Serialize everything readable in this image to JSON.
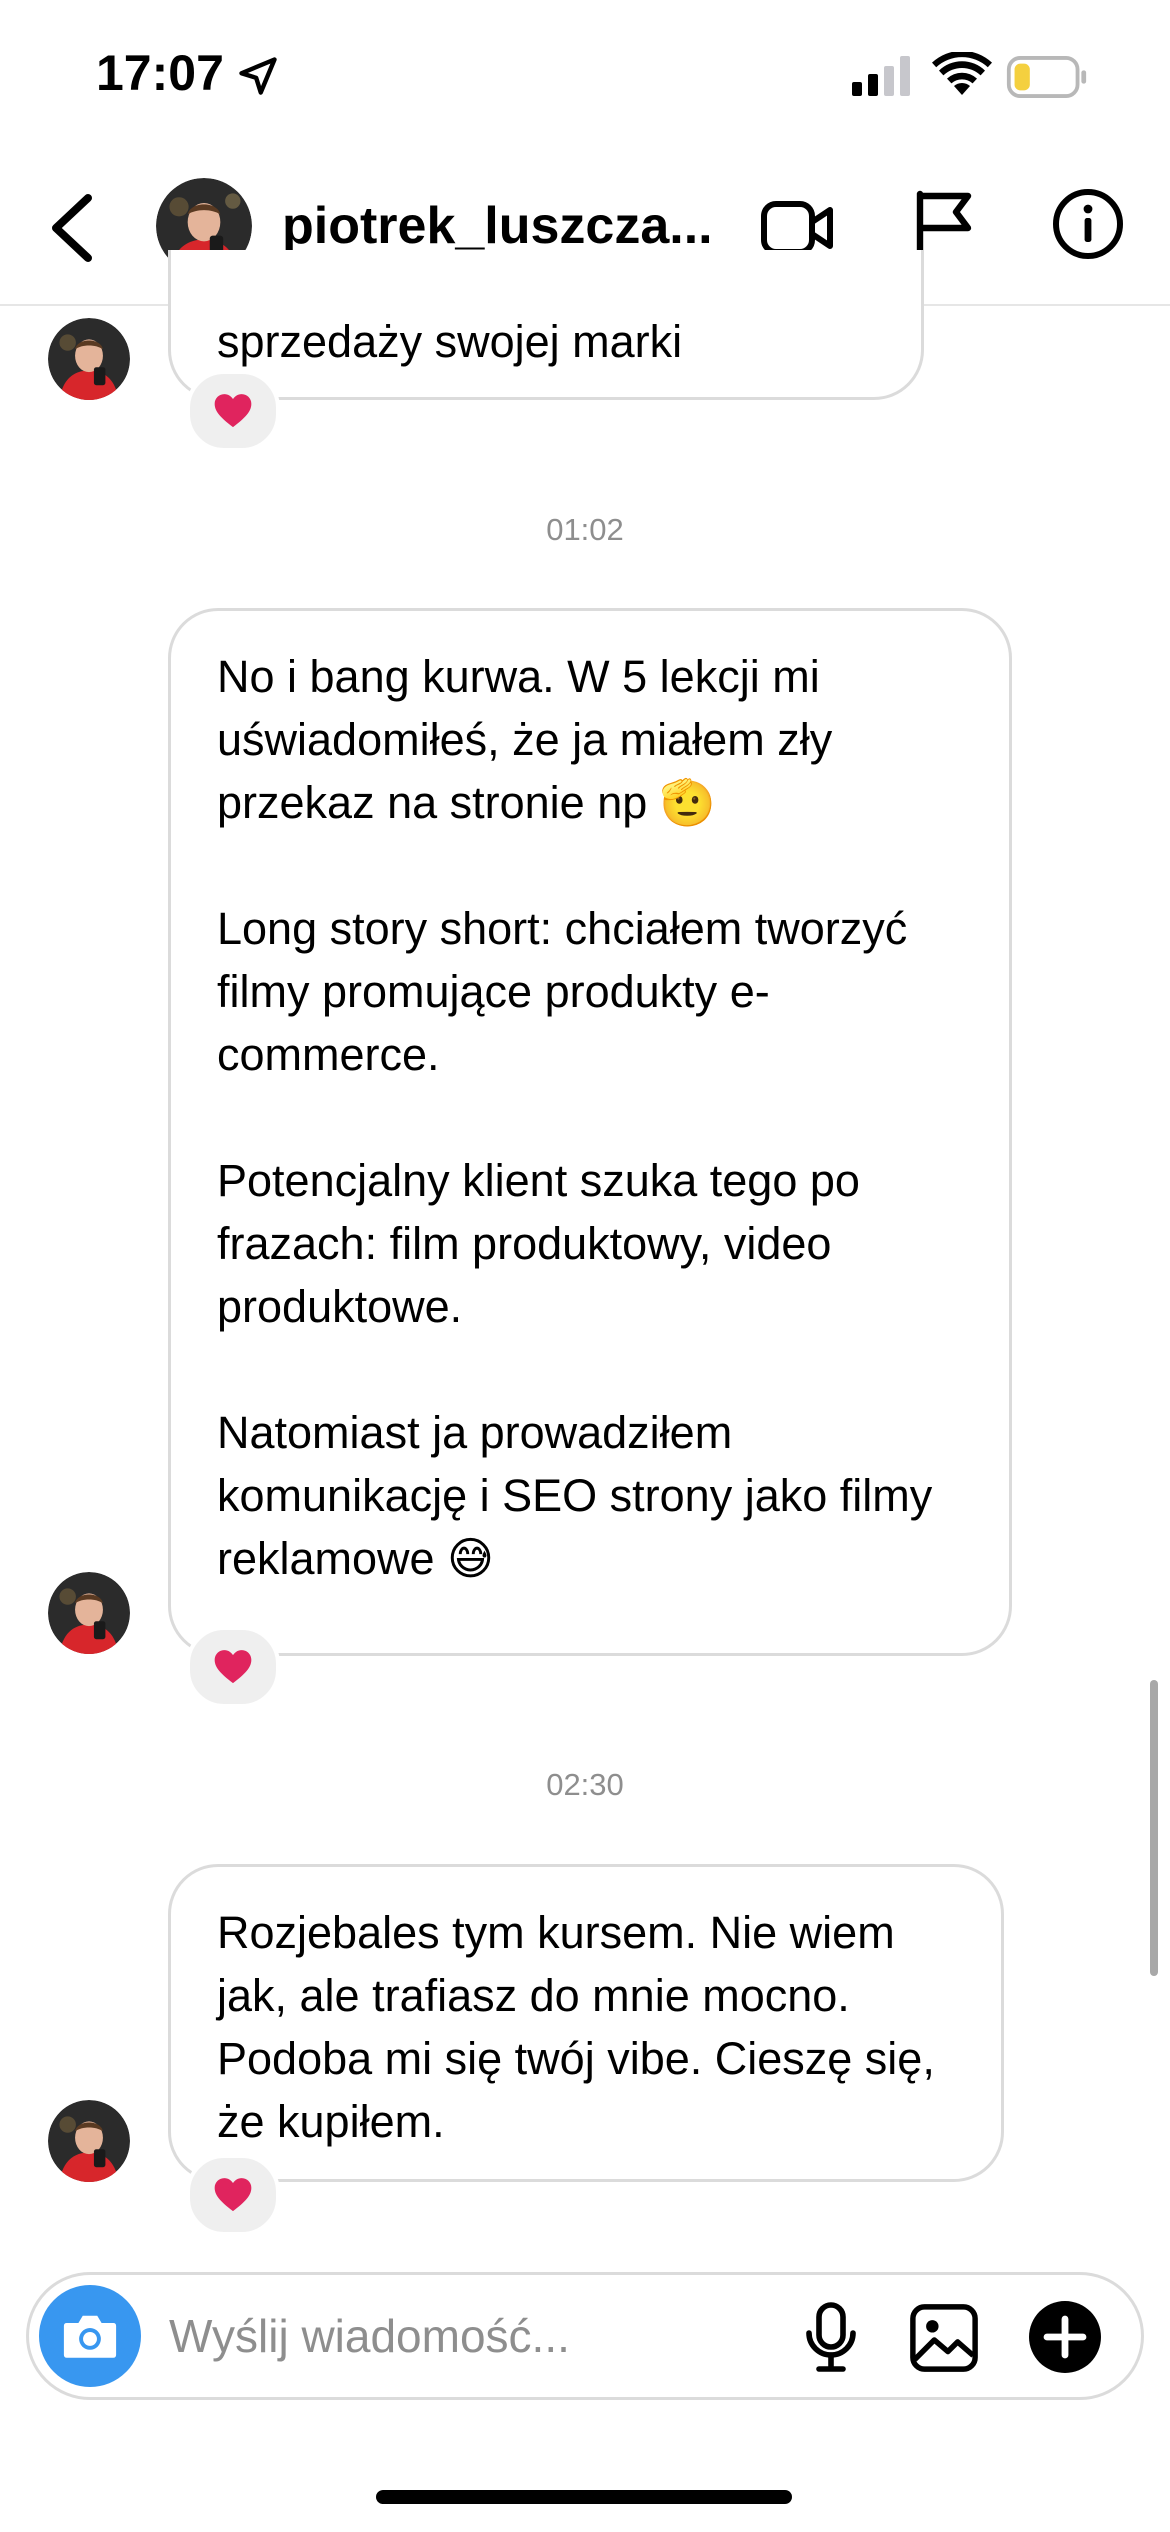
{
  "status_bar": {
    "time": "17:07",
    "icons": [
      "location-arrow-icon",
      "cellular-signal-icon",
      "wifi-icon",
      "battery-low-icon"
    ],
    "battery_color": "#f4d03f"
  },
  "header": {
    "username": "piotrek_luszcza...",
    "icons": [
      "back-chevron-icon",
      "video-call-icon",
      "flag-icon",
      "info-icon"
    ]
  },
  "messages": [
    {
      "lines": [
        "sprzedaży swojej marki"
      ],
      "reaction": "heart"
    },
    {
      "timestamp": "01:02",
      "paragraphs": [
        "No i bang kurwa. W 5 lekcji mi uświadomiłeś, że ja miałem zły przekaz na stronie np 🫡",
        "Long story short: chciałem tworzyć filmy promujące produkty e-commerce.",
        "Potencjalny klient szuka tego po frazach: film produktowy, video produktowe.",
        "Natomiast ja prowadziłem komunikację i SEO strony jako filmy reklamowe 😅"
      ],
      "reaction": "heart"
    },
    {
      "timestamp": "02:30",
      "paragraphs": [
        "Rozjebales tym kursem. Nie wiem jak, ale trafiasz do mnie mocno. Podoba mi się twój vibe. Cieszę się, że kupiłem."
      ],
      "reaction": "heart"
    }
  ],
  "composer": {
    "placeholder": "Wyślij wiadomość...",
    "icons": [
      "camera-icon",
      "microphone-icon",
      "gallery-icon",
      "plus-icon"
    ],
    "accent_color": "#3897f0"
  },
  "colors": {
    "reaction_heart": "#e0245e",
    "bubble_border": "#dbdbdb",
    "timestamp_text": "#8e8e8e"
  }
}
